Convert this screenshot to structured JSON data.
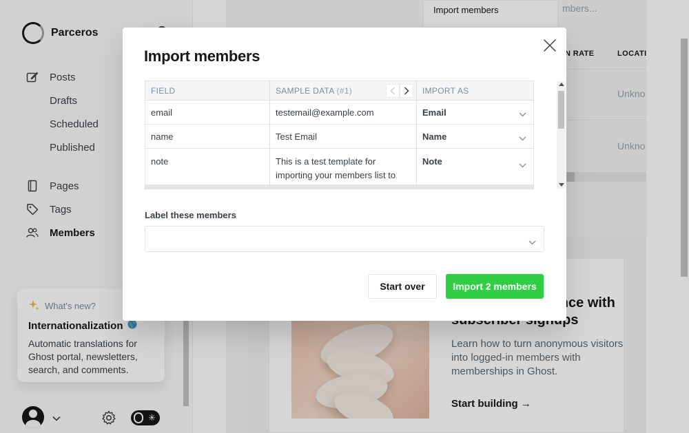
{
  "app": {
    "site_name": "Parceros"
  },
  "sidebar": {
    "nav": [
      {
        "label": "Posts",
        "icon": "pencil-square-icon"
      },
      {
        "label": "Drafts"
      },
      {
        "label": "Scheduled"
      },
      {
        "label": "Published"
      },
      {
        "label": "Pages",
        "icon": "page-icon"
      },
      {
        "label": "Tags",
        "icon": "tag-icon"
      },
      {
        "label": "Members",
        "icon": "members-icon",
        "active": true
      }
    ],
    "whats_new": {
      "kicker": "What's new?",
      "title": "Internationalization",
      "body": "Automatic translations for Ghost portal, newsletters, search, and comments."
    }
  },
  "background": {
    "dropdown_label": "Import members",
    "search_placeholder": "mbers...",
    "table_headers": [
      "N RATE",
      "LOCATI"
    ],
    "row_values": [
      "Unkno",
      "Unkno"
    ],
    "promo": {
      "heading": "Grow your audience with subscriber signups",
      "heading_visible_line1": "e with",
      "heading_visible_line2": "subscriber signups",
      "text": "Learn how to turn anonymous visitors into logged-in members with memberships in Ghost.",
      "link": "Start building →"
    }
  },
  "modal": {
    "title": "Import members",
    "table": {
      "headers": {
        "field": "FIELD",
        "sample": "SAMPLE DATA",
        "sample_index": "(#1)",
        "import_as": "IMPORT AS"
      },
      "rows": [
        {
          "field": "email",
          "sample": "testemail@example.com",
          "import_as": "Email"
        },
        {
          "field": "name",
          "sample": "Test Email",
          "import_as": "Name"
        },
        {
          "field": "note",
          "sample": "This is a test template for importing your members list to Ghost.",
          "import_as": "Note"
        }
      ]
    },
    "label_section": {
      "title": "Label these members",
      "value": ""
    },
    "buttons": {
      "start_over": "Start over",
      "import": "Import 2 members"
    }
  },
  "colors": {
    "accent_green": "#30cf43",
    "text_dark": "#15171a",
    "overlay": "rgba(0,0,0,0.16)"
  }
}
